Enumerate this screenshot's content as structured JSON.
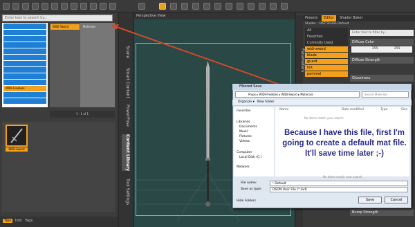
{
  "left_panel": {
    "search_placeholder": "Enter text to search by...",
    "tree_items": [
      "",
      "",
      "",
      "",
      "",
      "",
      "",
      "",
      "",
      "",
      "WIDI-Freebies",
      "",
      ""
    ],
    "col2_item": "WIDI-Sword",
    "col3_item": "Materials",
    "nav_text": "1 - 1 of 1",
    "thumb_label": "WIDI-Sword",
    "bottom_tabs": [
      "Tips",
      "Info",
      "Tags"
    ]
  },
  "side_tabs": [
    "Scene",
    "Smart Content",
    "PowerPose",
    "Content Library",
    "Tool Settings"
  ],
  "viewport": {
    "title": "Perspective View"
  },
  "right_panel": {
    "tabs": [
      "Presets",
      "Editor",
      "Shader Baker"
    ],
    "side_label": "Parameters",
    "shader_label": "Shader : DAZ Studio Default",
    "filter_placeholder": "Enter text to filter by...",
    "list_items": [
      "All",
      "Favorites",
      "Currently Used",
      "widi-sword",
      "blade",
      "guard",
      "hilt",
      "pommel"
    ],
    "props": [
      "Diffuse Color",
      "Diffuse Strength",
      "Glossiness",
      "Bump Strength"
    ],
    "color_values": [
      "255",
      "255"
    ]
  },
  "dialog": {
    "title": "Filtered Save",
    "address": "Props ▸ WIDI-Freebies ▸ WIDI-Sword ▸ Materials",
    "search_placeholder": "Search Materials",
    "organize": "Organize ▾",
    "new_folder": "New folder",
    "sidebar": [
      "Favorites",
      "Libraries",
      "Documents",
      "Music",
      "Pictures",
      "Videos",
      "Computer",
      "Local Disk (C:)",
      "Network"
    ],
    "headers": [
      "Name",
      "Date modified",
      "Type",
      "Size"
    ],
    "no_match": "No items match your search.",
    "annotation": "Because I have this file, first I'm going to create a default mat file. It'll save time later ;-)",
    "file_name_label": "File name:",
    "file_name": "! Default",
    "save_type_label": "Save as type:",
    "save_type": "DSON User File (*.duf)",
    "save": "Save",
    "cancel": "Cancel",
    "hide_folders": "Hide Folders"
  },
  "colors": {
    "accent": "#f5a01a",
    "tree_blue": "#1e7fd4",
    "viewport": "#2a4846"
  }
}
